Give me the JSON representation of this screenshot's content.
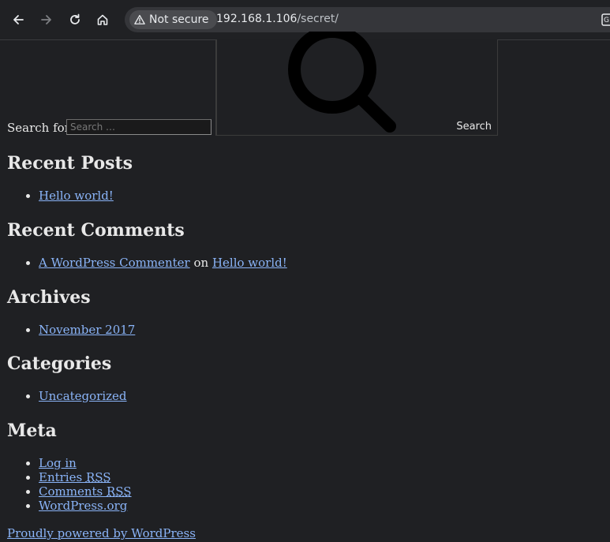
{
  "browser": {
    "security_label": "Not secure",
    "url_host": "192.168.1.106",
    "url_path": "/secret/"
  },
  "search": {
    "label": "Search for:",
    "placeholder": "Search …",
    "button_label": "Search"
  },
  "recent_posts": {
    "heading": "Recent Posts",
    "items": [
      "Hello world!"
    ]
  },
  "recent_comments": {
    "heading": "Recent Comments",
    "author": "A WordPress Commenter",
    "connector": "on",
    "post": "Hello world!"
  },
  "archives": {
    "heading": "Archives",
    "items": [
      "November 2017"
    ]
  },
  "categories": {
    "heading": "Categories",
    "items": [
      "Uncategorized"
    ]
  },
  "meta": {
    "heading": "Meta",
    "login": "Log in",
    "entries_prefix": "Entries ",
    "entries_abbr": "RSS",
    "comments_prefix": "Comments ",
    "comments_abbr": "RSS",
    "wordpress_org": "WordPress.org"
  },
  "footer": {
    "powered_by": "Proudly powered by WordPress"
  },
  "colors": {
    "page_bg": "#1f2023",
    "link": "#8ab4f8",
    "toolbar_bg": "#202124"
  }
}
